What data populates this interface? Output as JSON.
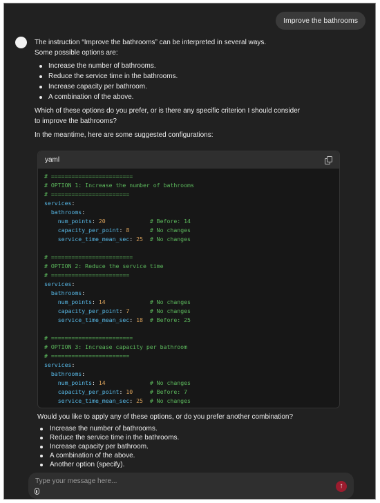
{
  "colors": {
    "background": "#212121",
    "bubble": "#3a3a3a",
    "code_bg": "#171717",
    "code_header": "#2f2f2f",
    "comment": "#5cb85c",
    "key": "#57b8e6",
    "number": "#d9a15a",
    "send_button": "#9b1c2e"
  },
  "user_message": "Improve the bathrooms",
  "assistant": {
    "intro_line1": "The instruction “Improve the bathrooms” can be interpreted in several ways.",
    "intro_line2": "Some possible options are:",
    "options": [
      "Increase the number of bathrooms.",
      "Reduce the service time in the bathrooms.",
      "Increase capacity per bathroom.",
      "A combination of the above."
    ],
    "question": "Which of these options do you prefer, or is there any specific criterion I should consider to improve the bathrooms?",
    "meantime": "In the meantime, here are some suggested configurations:",
    "code": {
      "language": "yaml",
      "copy_icon": "copy-icon",
      "lines": [
        [
          [
            "c-com",
            "# ========================"
          ]
        ],
        [
          [
            "c-com",
            "# OPTION 1: Increase the number of bathrooms"
          ]
        ],
        [
          [
            "c-com",
            "# ======================="
          ]
        ],
        [
          [
            "c-key",
            "services"
          ],
          [
            "c-txt",
            ":"
          ]
        ],
        [
          [
            "c-txt",
            "  "
          ],
          [
            "c-key",
            "bathrooms"
          ],
          [
            "c-txt",
            ":"
          ]
        ],
        [
          [
            "c-txt",
            "    "
          ],
          [
            "c-key",
            "num_points"
          ],
          [
            "c-txt",
            ": "
          ],
          [
            "c-num",
            "20"
          ],
          [
            "c-txt",
            "             "
          ],
          [
            "c-com",
            "# Before: 14"
          ]
        ],
        [
          [
            "c-txt",
            "    "
          ],
          [
            "c-key",
            "capacity_per_point"
          ],
          [
            "c-txt",
            ": "
          ],
          [
            "c-num",
            "8"
          ],
          [
            "c-txt",
            "      "
          ],
          [
            "c-com",
            "# No changes"
          ]
        ],
        [
          [
            "c-txt",
            "    "
          ],
          [
            "c-key",
            "service_time_mean_sec"
          ],
          [
            "c-txt",
            ": "
          ],
          [
            "c-num",
            "25"
          ],
          [
            "c-txt",
            "  "
          ],
          [
            "c-com",
            "# No changes"
          ]
        ],
        [],
        [
          [
            "c-com",
            "# ========================"
          ]
        ],
        [
          [
            "c-com",
            "# OPTION 2: Reduce the service time"
          ]
        ],
        [
          [
            "c-com",
            "# ======================="
          ]
        ],
        [
          [
            "c-key",
            "services"
          ],
          [
            "c-txt",
            ":"
          ]
        ],
        [
          [
            "c-txt",
            "  "
          ],
          [
            "c-key",
            "bathrooms"
          ],
          [
            "c-txt",
            ":"
          ]
        ],
        [
          [
            "c-txt",
            "    "
          ],
          [
            "c-key",
            "num_points"
          ],
          [
            "c-txt",
            ": "
          ],
          [
            "c-num",
            "14"
          ],
          [
            "c-txt",
            "             "
          ],
          [
            "c-com",
            "# No changes"
          ]
        ],
        [
          [
            "c-txt",
            "    "
          ],
          [
            "c-key",
            "capacity_per_point"
          ],
          [
            "c-txt",
            ": "
          ],
          [
            "c-num",
            "7"
          ],
          [
            "c-txt",
            "      "
          ],
          [
            "c-com",
            "# No changes"
          ]
        ],
        [
          [
            "c-txt",
            "    "
          ],
          [
            "c-key",
            "service_time_mean_sec"
          ],
          [
            "c-txt",
            ": "
          ],
          [
            "c-num",
            "18"
          ],
          [
            "c-txt",
            "  "
          ],
          [
            "c-com",
            "# Before: 25"
          ]
        ],
        [],
        [
          [
            "c-com",
            "# ========================"
          ]
        ],
        [
          [
            "c-com",
            "# OPTION 3: Increase capacity per bathroom"
          ]
        ],
        [
          [
            "c-com",
            "# ======================="
          ]
        ],
        [
          [
            "c-key",
            "services"
          ],
          [
            "c-txt",
            ":"
          ]
        ],
        [
          [
            "c-txt",
            "  "
          ],
          [
            "c-key",
            "bathrooms"
          ],
          [
            "c-txt",
            ":"
          ]
        ],
        [
          [
            "c-txt",
            "    "
          ],
          [
            "c-key",
            "num_points"
          ],
          [
            "c-txt",
            ": "
          ],
          [
            "c-num",
            "14"
          ],
          [
            "c-txt",
            "             "
          ],
          [
            "c-com",
            "# No changes"
          ]
        ],
        [
          [
            "c-txt",
            "    "
          ],
          [
            "c-key",
            "capacity_per_point"
          ],
          [
            "c-txt",
            ": "
          ],
          [
            "c-num",
            "10"
          ],
          [
            "c-txt",
            "     "
          ],
          [
            "c-com",
            "# Before: 7"
          ]
        ],
        [
          [
            "c-txt",
            "    "
          ],
          [
            "c-key",
            "service_time_mean_sec"
          ],
          [
            "c-txt",
            ": "
          ],
          [
            "c-num",
            "25"
          ],
          [
            "c-txt",
            "  "
          ],
          [
            "c-com",
            "# No changes"
          ]
        ]
      ]
    },
    "followup": "Would you like to apply any of these options, or do you prefer another combination?",
    "followup_options": [
      "Increase the number of bathrooms.",
      "Reduce the service time in the bathrooms.",
      "Increase capacity per bathroom.",
      "A combination of the above.",
      "Another option (specify)."
    ]
  },
  "composer": {
    "placeholder": "Type your message here...",
    "attach_icon": "paperclip-icon",
    "send_icon": "arrow-up-icon",
    "send_glyph": "↑"
  }
}
